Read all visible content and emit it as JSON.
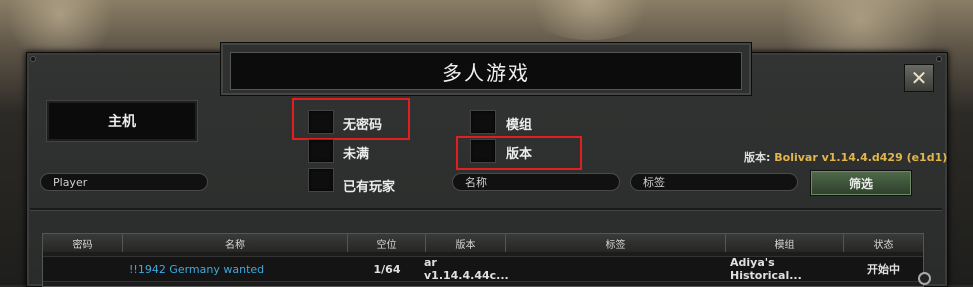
{
  "window": {
    "title": "多人游戏",
    "close_glyph": "✕"
  },
  "host_button": "主机",
  "filters": {
    "no_password": "无密码",
    "not_full": "未满",
    "has_players": "已有玩家",
    "mods": "模组",
    "version": "版本"
  },
  "inputs": {
    "player_name": "Player",
    "name_placeholder": "名称",
    "tags_placeholder": "标签"
  },
  "version_info": {
    "label": "版本:",
    "value": "Bolivar v1.14.4.d429 (e1d1)"
  },
  "filter_button": "筛选",
  "table": {
    "columns": [
      "密码",
      "名称",
      "空位",
      "版本",
      "标签",
      "模组",
      "状态"
    ],
    "rows": [
      {
        "password": "",
        "name": "!!1942 Germany wanted",
        "slots": "1/64",
        "version": "ar v1.14.4.44c...",
        "tags": "",
        "mods": "Adiya's Historical...",
        "status": "开始中"
      }
    ]
  },
  "colors": {
    "accent_link": "#3fa9e0",
    "version_value": "#e2b64a",
    "highlight": "#e02020"
  }
}
